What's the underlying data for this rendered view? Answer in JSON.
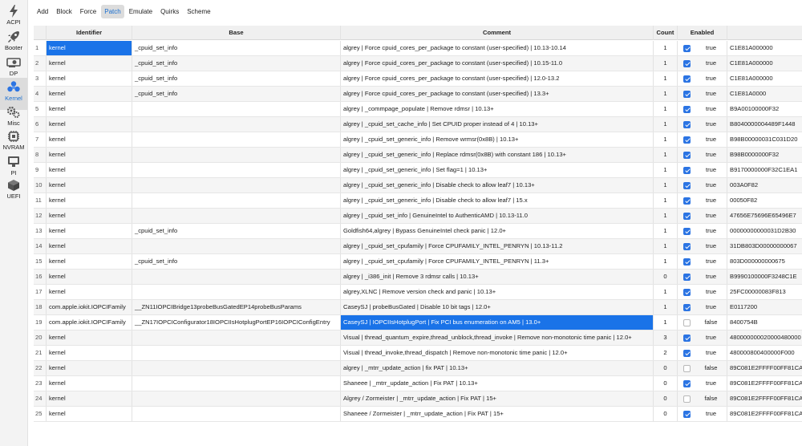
{
  "sidebar": [
    {
      "label": "ACPI",
      "icon": "bolt-icon"
    },
    {
      "label": "Booter",
      "icon": "rocket-icon"
    },
    {
      "label": "DP",
      "icon": "gpu-card-icon"
    },
    {
      "label": "Kernel",
      "icon": "kernel-icon",
      "active": true
    },
    {
      "label": "Misc",
      "icon": "gears-icon"
    },
    {
      "label": "NVRAM",
      "icon": "chip-icon"
    },
    {
      "label": "PI",
      "icon": "monitor-icon"
    },
    {
      "label": "UEFI",
      "icon": "cube-icon"
    }
  ],
  "toolbar": {
    "buttons": [
      "Add",
      "Block",
      "Force",
      "Patch",
      "Emulate",
      "Quirks",
      "Scheme"
    ],
    "active": "Patch"
  },
  "table": {
    "headers": {
      "identifier": "Identifier",
      "base": "Base",
      "comment": "Comment",
      "count": "Count",
      "enabled": "Enabled",
      "find": ""
    },
    "rows": [
      {
        "n": "1",
        "id": "kernel",
        "base": "_cpuid_set_info",
        "comment": "algrey | Force cpuid_cores_per_package to constant (user-specified) | 10.13-10.14",
        "count": "1",
        "checked": true,
        "enabled": "true",
        "find": "C1E81A000000"
      },
      {
        "n": "2",
        "id": "kernel",
        "base": "_cpuid_set_info",
        "comment": "algrey | Force cpuid_cores_per_package to constant (user-specified) | 10.15-11.0",
        "count": "1",
        "checked": true,
        "enabled": "true",
        "find": "C1E81A000000"
      },
      {
        "n": "3",
        "id": "kernel",
        "base": "_cpuid_set_info",
        "comment": "algrey | Force cpuid_cores_per_package to constant (user-specified) | 12.0-13.2",
        "count": "1",
        "checked": true,
        "enabled": "true",
        "find": "C1E81A000000"
      },
      {
        "n": "4",
        "id": "kernel",
        "base": "_cpuid_set_info",
        "comment": "algrey | Force cpuid_cores_per_package to constant (user-specified) | 13.3+",
        "count": "1",
        "checked": true,
        "enabled": "true",
        "find": "C1E81A0000"
      },
      {
        "n": "5",
        "id": "kernel",
        "base": "",
        "comment": "algrey | _commpage_populate | Remove rdmsr | 10.13+",
        "count": "1",
        "checked": true,
        "enabled": "true",
        "find": "B9A00100000F32"
      },
      {
        "n": "6",
        "id": "kernel",
        "base": "",
        "comment": "algrey | _cpuid_set_cache_info | Set CPUID proper instead of 4 | 10.13+",
        "count": "1",
        "checked": true,
        "enabled": "true",
        "find": "B8040000004489F1448"
      },
      {
        "n": "7",
        "id": "kernel",
        "base": "",
        "comment": "algrey | _cpuid_set_generic_info | Remove wrmsr(0x8B) | 10.13+",
        "count": "1",
        "checked": true,
        "enabled": "true",
        "find": "B98B00000031C031D20"
      },
      {
        "n": "8",
        "id": "kernel",
        "base": "",
        "comment": "algrey | _cpuid_set_generic_info | Replace rdmsr(0x8B) with constant 186 | 10.13+",
        "count": "1",
        "checked": true,
        "enabled": "true",
        "find": "B98B0000000F32"
      },
      {
        "n": "9",
        "id": "kernel",
        "base": "",
        "comment": "algrey | _cpuid_set_generic_info | Set flag=1 | 10.13+",
        "count": "1",
        "checked": true,
        "enabled": "true",
        "find": "B9170000000F32C1EA1"
      },
      {
        "n": "10",
        "id": "kernel",
        "base": "",
        "comment": "algrey | _cpuid_set_generic_info | Disable check to allow leaf7 | 10.13+",
        "count": "1",
        "checked": true,
        "enabled": "true",
        "find": "003A0F82"
      },
      {
        "n": "11",
        "id": "kernel",
        "base": "",
        "comment": "algrey | _cpuid_set_generic_info | Disable check to allow leaf7 | 15.x",
        "count": "1",
        "checked": true,
        "enabled": "true",
        "find": "00050F82"
      },
      {
        "n": "12",
        "id": "kernel",
        "base": "",
        "comment": "algrey | _cpuid_set_info | GenuineIntel to AuthenticAMD | 10.13-11.0",
        "count": "1",
        "checked": true,
        "enabled": "true",
        "find": "47656E75696E65496E7"
      },
      {
        "n": "13",
        "id": "kernel",
        "base": "_cpuid_set_info",
        "comment": "Goldfish64,algrey | Bypass GenuineIntel check panic | 12.0+",
        "count": "1",
        "checked": true,
        "enabled": "true",
        "find": "00000000000031D2B30"
      },
      {
        "n": "14",
        "id": "kernel",
        "base": "",
        "comment": "algrey | _cpuid_set_cpufamily | Force CPUFAMILY_INTEL_PENRYN | 10.13-11.2",
        "count": "1",
        "checked": true,
        "enabled": "true",
        "find": "31DB803D00000000067"
      },
      {
        "n": "15",
        "id": "kernel",
        "base": "_cpuid_set_info",
        "comment": "algrey | _cpuid_set_cpufamily | Force CPUFAMILY_INTEL_PENRYN | 11.3+",
        "count": "1",
        "checked": true,
        "enabled": "true",
        "find": "803D000000000675"
      },
      {
        "n": "16",
        "id": "kernel",
        "base": "",
        "comment": "algrey | _i386_init | Remove 3 rdmsr calls | 10.13+",
        "count": "0",
        "checked": true,
        "enabled": "true",
        "find": "B9990100000F3248C1E"
      },
      {
        "n": "17",
        "id": "kernel",
        "base": "",
        "comment": "algrey,XLNC | Remove version check and panic | 10.13+",
        "count": "1",
        "checked": true,
        "enabled": "true",
        "find": "25FC00000083F813"
      },
      {
        "n": "18",
        "id": "com.apple.iokit.IOPCIFamily",
        "base": "__ZN11IOPCIBridge13probeBusGatedEP14probeBusParams",
        "comment": "CaseySJ | probeBusGated | Disable 10 bit tags | 12.0+",
        "count": "1",
        "checked": true,
        "enabled": "true",
        "find": "E0117200"
      },
      {
        "n": "19",
        "id": "com.apple.iokit.IOPCIFamily",
        "base": "__ZN17IOPCIConfigurator18IOPCIIsHotplugPortEP16IOPCIConfigEntry",
        "comment": "CaseySJ | IOPCIIsHotplugPort | Fix PCI bus enumeration on AM5 | 13.0+",
        "count": "1",
        "checked": false,
        "enabled": "false",
        "find": "8400754B"
      },
      {
        "n": "20",
        "id": "kernel",
        "base": "",
        "comment": "Visual | thread_quantum_expire,thread_unblock,thread_invoke | Remove non-monotonic time panic | 12.0+",
        "count": "3",
        "checked": true,
        "enabled": "true",
        "find": "480000000020000480000"
      },
      {
        "n": "21",
        "id": "kernel",
        "base": "",
        "comment": "Visual | thread_invoke,thread_dispatch | Remove non-monotonic time panic | 12.0+",
        "count": "2",
        "checked": true,
        "enabled": "true",
        "find": "480000800400000F000"
      },
      {
        "n": "22",
        "id": "kernel",
        "base": "",
        "comment": "algrey | _mtrr_update_action | fix PAT | 10.13+",
        "count": "0",
        "checked": false,
        "enabled": "false",
        "find": "89C081E2FFFF00FF81CA"
      },
      {
        "n": "23",
        "id": "kernel",
        "base": "",
        "comment": "Shaneee | _mtrr_update_action | Fix PAT | 10.13+",
        "count": "0",
        "checked": true,
        "enabled": "true",
        "find": "89C081E2FFFF00FF81CA"
      },
      {
        "n": "24",
        "id": "kernel",
        "base": "",
        "comment": "Algrey / Zormeister | _mtrr_update_action | Fix PAT | 15+",
        "count": "0",
        "checked": false,
        "enabled": "false",
        "find": "89C081E2FFFF00FF81CA"
      },
      {
        "n": "25",
        "id": "kernel",
        "base": "",
        "comment": "Shaneee / Zormeister | _mtrr_update_action | Fix PAT | 15+",
        "count": "0",
        "checked": true,
        "enabled": "true",
        "find": "89C081E2FFFF00FF81CA"
      }
    ]
  },
  "colors": {
    "accent": "#1a73e8",
    "checkbox": "#2b74e3",
    "selected_label": "#1a6fd1"
  }
}
